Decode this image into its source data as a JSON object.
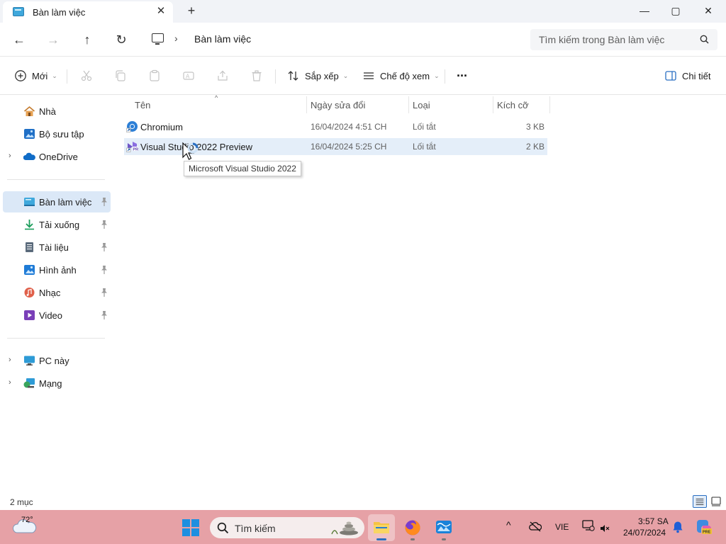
{
  "window": {
    "tab_title": "Bàn làm việc",
    "tab_close": "✕",
    "tab_add": "+",
    "controls": {
      "minimize": "—",
      "maximize": "▢",
      "close": "✕"
    }
  },
  "address": {
    "back": "←",
    "forward": "→",
    "up": "↑",
    "refresh": "↻",
    "chevron": "›",
    "location": "Bàn làm việc",
    "search_placeholder": "Tìm kiếm trong Bàn làm việc"
  },
  "commands": {
    "new_label": "Mới",
    "sort_label": "Sắp xếp",
    "view_label": "Chế độ xem",
    "more_label": "···",
    "details_label": "Chi tiết",
    "dropdown_glyph": "⌄"
  },
  "sidebar": {
    "expand_glyph": "›",
    "top_items": [
      {
        "label": "Nhà",
        "icon": "home-icon"
      },
      {
        "label": "Bộ sưu tập",
        "icon": "gallery-icon"
      },
      {
        "label": "OneDrive",
        "icon": "onedrive-icon"
      }
    ],
    "pinned_items": [
      {
        "label": "Bàn làm việc",
        "icon": "desktop-icon",
        "selected": true
      },
      {
        "label": "Tải xuống",
        "icon": "downloads-icon"
      },
      {
        "label": "Tài liệu",
        "icon": "documents-icon"
      },
      {
        "label": "Hình ảnh",
        "icon": "pictures-icon"
      },
      {
        "label": "Nhạc",
        "icon": "music-icon"
      },
      {
        "label": "Video",
        "icon": "videos-icon"
      }
    ],
    "bottom_items": [
      {
        "label": "PC này",
        "icon": "this-pc-icon"
      },
      {
        "label": "Mạng",
        "icon": "network-icon"
      }
    ]
  },
  "files": {
    "columns": [
      "Tên",
      "Ngày sửa đổi",
      "Loại",
      "Kích cỡ"
    ],
    "sort_glyph": "^",
    "rows": [
      {
        "name": "Chromium",
        "date": "16/04/2024 4:51 CH",
        "type": "Lối tắt",
        "size": "3 KB",
        "icon": "chromium-icon"
      },
      {
        "name": "Visual Studio 2022 Preview",
        "date": "16/04/2024 5:25 CH",
        "type": "Lối tắt",
        "size": "2 KB",
        "icon": "visual-studio-preview-icon"
      }
    ],
    "tooltip": "Microsoft Visual Studio 2022"
  },
  "status": {
    "item_count": "2 mục"
  },
  "taskbar": {
    "weather_temp": "72°",
    "search_placeholder": "Tìm kiếm",
    "language": "VIE",
    "time": "3:57 SA",
    "date": "24/07/2024",
    "colors": {
      "background": "#e6a1a6",
      "accent": "#2a6fc2"
    }
  }
}
